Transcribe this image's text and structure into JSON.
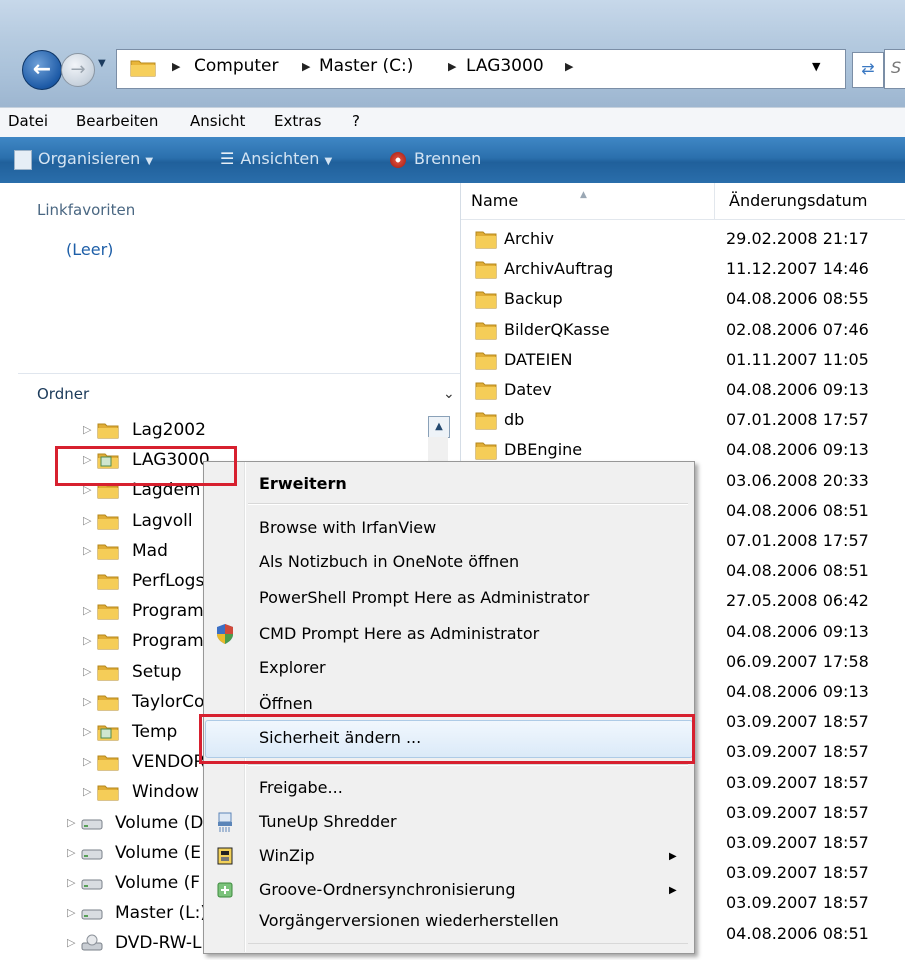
{
  "address_bar": {
    "breadcrumbs": [
      "Computer",
      "Master (C:)",
      "LAG3000"
    ],
    "search_placeholder": "S"
  },
  "menu_bar": [
    "Datei",
    "Bearbeiten",
    "Ansicht",
    "Extras",
    "?"
  ],
  "command_bar": {
    "organize": "Organisieren",
    "views": "Ansichten",
    "burn": "Brennen"
  },
  "left_pane": {
    "favorites_header": "Linkfavoriten",
    "favorites_empty": "(Leer)",
    "folders_header": "Ordner",
    "tree": [
      {
        "label": "Lag2002",
        "icon": "folder-icon"
      },
      {
        "label": "LAG3000",
        "icon": "shared-folder-icon"
      },
      {
        "label": "Lagdem",
        "icon": "folder-icon"
      },
      {
        "label": "Lagvoll",
        "icon": "folder-icon"
      },
      {
        "label": "Mad",
        "icon": "folder-icon"
      },
      {
        "label": "PerfLogs",
        "icon": "folder-icon"
      },
      {
        "label": "Program",
        "icon": "folder-icon"
      },
      {
        "label": "Program",
        "icon": "folder-icon"
      },
      {
        "label": "Setup",
        "icon": "folder-icon"
      },
      {
        "label": "TaylorCo",
        "icon": "folder-icon"
      },
      {
        "label": "Temp",
        "icon": "shared-folder-icon"
      },
      {
        "label": "VENDOR",
        "icon": "folder-icon"
      },
      {
        "label": "Window",
        "icon": "folder-icon"
      },
      {
        "label": "Volume (D",
        "icon": "drive-icon"
      },
      {
        "label": "Volume (E",
        "icon": "drive-icon"
      },
      {
        "label": "Volume (F",
        "icon": "drive-icon"
      },
      {
        "label": "Master (L:)",
        "icon": "drive-icon"
      },
      {
        "label": "DVD-RW-L",
        "icon": "dvd-drive-icon"
      }
    ]
  },
  "file_list": {
    "columns": [
      "Name",
      "Änderungsdatum"
    ],
    "rows": [
      {
        "name": "Archiv",
        "date": "29.02.2008 21:17"
      },
      {
        "name": "ArchivAuftrag",
        "date": "11.12.2007 14:46"
      },
      {
        "name": "Backup",
        "date": "04.08.2006 08:55"
      },
      {
        "name": "BilderQKasse",
        "date": "02.08.2006 07:46"
      },
      {
        "name": "DATEIEN",
        "date": "01.11.2007 11:05"
      },
      {
        "name": "Datev",
        "date": "04.08.2006 09:13"
      },
      {
        "name": "db",
        "date": "07.01.2008 17:57"
      },
      {
        "name": "DBEngine",
        "date": "04.08.2006 09:13"
      },
      {
        "name": "",
        "date": "03.06.2008 20:33"
      },
      {
        "name": "",
        "date": "04.08.2006 08:51"
      },
      {
        "name": "",
        "date": "07.01.2008 17:57"
      },
      {
        "name": "",
        "date": "04.08.2006 08:51"
      },
      {
        "name": "",
        "date": "27.05.2008 06:42"
      },
      {
        "name": "",
        "date": "04.08.2006 09:13"
      },
      {
        "name": "",
        "date": "06.09.2007 17:58"
      },
      {
        "name": "",
        "date": "04.08.2006 09:13"
      },
      {
        "name": "",
        "date": "03.09.2007 18:57"
      },
      {
        "name": "",
        "date": "03.09.2007 18:57"
      },
      {
        "name": "",
        "date": "03.09.2007 18:57"
      },
      {
        "name": "",
        "date": "03.09.2007 18:57"
      },
      {
        "name": "",
        "date": "03.09.2007 18:57"
      },
      {
        "name": "",
        "date": "03.09.2007 18:57"
      },
      {
        "name": "",
        "date": "03.09.2007 18:57"
      },
      {
        "name": "",
        "date": "04.08.2006 08:51"
      }
    ]
  },
  "context_menu": {
    "items": [
      {
        "label": "Erweitern",
        "bold": true
      },
      {
        "label": "Browse with IrfanView"
      },
      {
        "label": "Als Notizbuch in OneNote öffnen"
      },
      {
        "label": "PowerShell Prompt Here as Administrator"
      },
      {
        "label": "CMD Prompt Here as Administrator",
        "icon": "uac-shield-icon"
      },
      {
        "label": "Explorer"
      },
      {
        "label": "Öffnen"
      },
      {
        "label": "Sicherheit ändern ...",
        "highlighted": true
      },
      {
        "label": "Freigabe..."
      },
      {
        "label": "TuneUp Shredder",
        "icon": "shredder-icon"
      },
      {
        "label": "WinZip",
        "icon": "winzip-icon",
        "submenu": true
      },
      {
        "label": "Groove-Ordnersynchronisierung",
        "icon": "groove-icon",
        "submenu": true
      },
      {
        "label": "Vorgängerversionen wiederherstellen"
      }
    ]
  },
  "colors": {
    "highlight_box": "#d7202f",
    "command_bar": "#2b70ad"
  }
}
